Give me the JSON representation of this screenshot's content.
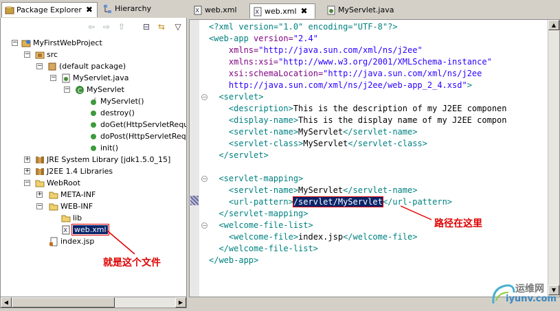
{
  "left_tabs": [
    {
      "label": "Package Explorer",
      "icon": "package-explorer-icon",
      "close": "✖"
    },
    {
      "label": "Hierarchy",
      "icon": "hierarchy-icon"
    }
  ],
  "tree": {
    "project": "MyFirstWebProject",
    "src": "src",
    "default_package": "(default package)",
    "servlet_file": "MyServlet.java",
    "servlet_class": "MyServlet",
    "methods": [
      "MyServlet()",
      "destroy()",
      "doGet(HttpServletReque",
      "doPost(HttpServletReque",
      "init()"
    ],
    "jre": "JRE System Library [jdk1.5.0_15]",
    "j2ee": "J2EE 1.4 Libraries",
    "webroot": "WebRoot",
    "meta_inf": "META-INF",
    "web_inf": "WEB-INF",
    "lib": "lib",
    "webxml": "web.xml",
    "indexjsp": "index.jsp"
  },
  "editor_tabs": [
    {
      "label": "web.xml"
    },
    {
      "label": "web.xml",
      "close": "✖"
    },
    {
      "label": "MyServlet.java"
    }
  ],
  "code": {
    "l1a": "<?xml version=\"1.0\" encoding=\"UTF-8\"?>",
    "l2t": "<web-app",
    "l2a": " version=",
    "l2v": "\"2.4\"",
    "l3a": "    xmlns=",
    "l3v": "\"http://java.sun.com/xml/ns/j2ee\"",
    "l4a": "    xmlns:xsi=",
    "l4v": "\"http://www.w3.org/2001/XMLSchema-instance\"",
    "l5a": "    xsi:schemaLocation=",
    "l5v": "\"http://java.sun.com/xml/ns/j2ee",
    "l6v": "    http://java.sun.com/xml/ns/j2ee/web-app_2_4.xsd\"",
    "l6t": ">",
    "l7t": "  <servlet>",
    "l8t1": "    <description>",
    "l8b": "This is the description of my J2EE componen",
    "l9t1": "    <display-name>",
    "l9b": "This is the display name of my J2EE compon",
    "l10t1": "    <servlet-name>",
    "l10b": "MyServlet",
    "l10t2": "</servlet-name>",
    "l11t1": "    <servlet-class>",
    "l11b": "MyServlet",
    "l11t2": "</servlet-class>",
    "l12t": "  </servlet>",
    "l14t": "  <servlet-mapping>",
    "l15t1": "    <servlet-name>",
    "l15b": "MyServlet",
    "l15t2": "</servlet-name>",
    "l16t1": "    <url-pattern>",
    "l16b": "/servlet/MyServlet",
    "l16t2": "</url-pattern>",
    "l17t": "  </servlet-mapping>",
    "l18t": "  <welcome-file-list>",
    "l19t1": "    <welcome-file>",
    "l19b": "index.jsp",
    "l19t2": "</welcome-file>",
    "l20t": "  </welcome-file-list>",
    "l21t": "</web-app>"
  },
  "annotations": {
    "file": "就是这个文件",
    "path": "路径在这里"
  },
  "watermark": {
    "cn": "运维网",
    "url": "iyunv.com"
  },
  "colors": {
    "tag": "#008080",
    "attr": "#7f007f",
    "value": "#2a00ff",
    "annotation": "#e00000",
    "selection": "#0a246a"
  }
}
